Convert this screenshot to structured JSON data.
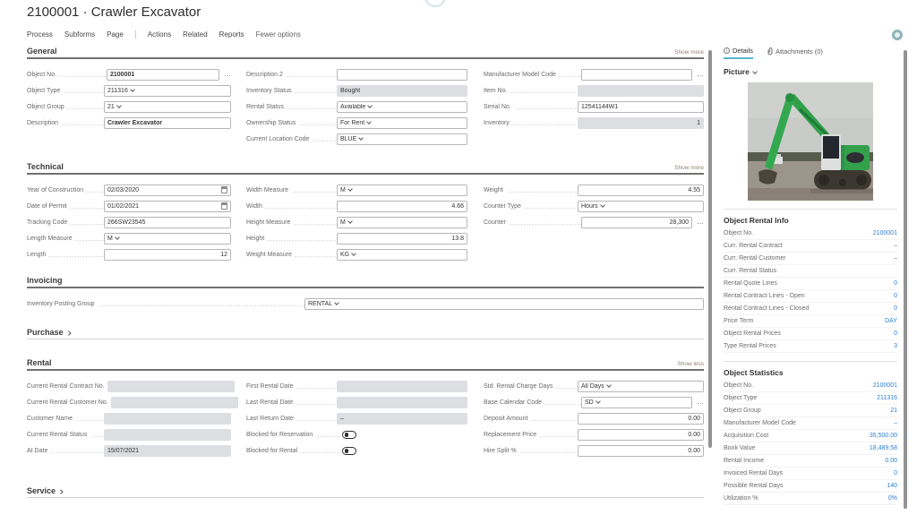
{
  "header": {
    "title": "2100001 · Crawler Excavator"
  },
  "menubar": {
    "items": [
      "Process",
      "Subforms",
      "Page",
      "Actions",
      "Related",
      "Reports",
      "Fewer options"
    ]
  },
  "icons": {
    "ellipsis": "…",
    "info": "i"
  },
  "general": {
    "title": "General",
    "more": "Show more",
    "objectNo": {
      "label": "Object No.",
      "value": "2100001"
    },
    "objectType": {
      "label": "Object Type",
      "value": "211316"
    },
    "objectGroup": {
      "label": "Object Group",
      "value": "21"
    },
    "description": {
      "label": "Description",
      "value": "Crawler Excavator"
    },
    "description2": {
      "label": "Description 2",
      "value": ""
    },
    "inventoryStatus": {
      "label": "Inventory Status",
      "value": "Bought"
    },
    "rentalStatus": {
      "label": "Rental Status",
      "value": "Available"
    },
    "ownershipStatus": {
      "label": "Ownership Status",
      "value": "For Rent"
    },
    "currentLocationCode": {
      "label": "Current Location Code",
      "value": "BLUE"
    },
    "manufacturerModelCode": {
      "label": "Manufacturer Model Code",
      "value": ""
    },
    "itemNo": {
      "label": "Item No.",
      "value": ""
    },
    "serialNo": {
      "label": "Serial No.",
      "value": "12541144W1"
    },
    "inventory": {
      "label": "Inventory",
      "value": "1"
    }
  },
  "technical": {
    "title": "Technical",
    "more": "Show more",
    "yearOfConstruction": {
      "label": "Year of Construction",
      "value": "02/03/2020"
    },
    "dateOfPermit": {
      "label": "Date of Permit",
      "value": "01/02/2021"
    },
    "trackingCode": {
      "label": "Tracking Code",
      "value": "266SW23545"
    },
    "lengthMeasure": {
      "label": "Length Measure",
      "value": "M"
    },
    "length": {
      "label": "Length",
      "value": "12"
    },
    "widthMeasure": {
      "label": "Width Measure",
      "value": "M"
    },
    "width": {
      "label": "Width",
      "value": "4.66"
    },
    "heightMeasure": {
      "label": "Height Measure",
      "value": "M"
    },
    "height": {
      "label": "Height",
      "value": "13.8"
    },
    "weightMeasure": {
      "label": "Weight Measure",
      "value": "KG"
    },
    "weight": {
      "label": "Weight",
      "value": "4.55"
    },
    "counterType": {
      "label": "Counter Type",
      "value": "Hours"
    },
    "counter": {
      "label": "Counter",
      "value": "28,300"
    }
  },
  "invoicing": {
    "title": "Invoicing",
    "inventoryPostingGroup": {
      "label": "Inventory Posting Group",
      "value": "RENTAL"
    }
  },
  "purchase": {
    "title": "Purchase"
  },
  "rental": {
    "title": "Rental",
    "less": "Show less",
    "currentRentalContractNo": {
      "label": "Current Rental Contract No.",
      "value": ""
    },
    "currentRentalCustomerNo": {
      "label": "Current Rental Customer No.",
      "value": ""
    },
    "customerName": {
      "label": "Customer Name",
      "value": ""
    },
    "currentRentalStatus": {
      "label": "Current Rental Status",
      "value": ""
    },
    "atDate": {
      "label": "At Date",
      "value": "15/07/2021"
    },
    "firstRentalDate": {
      "label": "First Rental Date",
      "value": ""
    },
    "lastRentalDate": {
      "label": "Last Rental Date",
      "value": ""
    },
    "lastReturnDate": {
      "label": "Last Return Date",
      "value": "–"
    },
    "blockedForReservation": {
      "label": "Blocked for Reservation"
    },
    "blockedForRental": {
      "label": "Blocked for Rental"
    },
    "stdRentalChargeDays": {
      "label": "Std. Rental Charge Days",
      "value": "All Days"
    },
    "baseCalendarCode": {
      "label": "Base Calendar Code",
      "value": "SD"
    },
    "depositAmount": {
      "label": "Deposit Amount",
      "value": "0.00"
    },
    "replacementPrice": {
      "label": "Replacement Price",
      "value": "0.00"
    },
    "hireSplit": {
      "label": "Hire Split %",
      "value": "0.00"
    }
  },
  "service": {
    "title": "Service"
  },
  "panel": {
    "tabs": {
      "details": "Details",
      "attachments": "Attachments (0)"
    },
    "picture": {
      "title": "Picture"
    },
    "rentalInfo": {
      "title": "Object Rental Info",
      "rows": [
        {
          "label": "Object No.",
          "value": "2100001"
        },
        {
          "label": "Curr. Rental Contract",
          "value": "–"
        },
        {
          "label": "Curr. Rental Customer",
          "value": "–"
        },
        {
          "label": "Curr. Rental Status",
          "value": ""
        },
        {
          "label": "Rental Quote Lines",
          "value": "0"
        },
        {
          "label": "Rental Contract Lines - Open",
          "value": "0"
        },
        {
          "label": "Rental Contract Lines - Closed",
          "value": "0"
        },
        {
          "label": "Price Term",
          "value": "DAY"
        },
        {
          "label": "Object Rental Prices",
          "value": "0"
        },
        {
          "label": "Type Rental Prices",
          "value": "3"
        }
      ]
    },
    "statistics": {
      "title": "Object Statistics",
      "rows": [
        {
          "label": "Object No.",
          "value": "2100001"
        },
        {
          "label": "Object Type",
          "value": "211316"
        },
        {
          "label": "Object Group",
          "value": "21"
        },
        {
          "label": "Manufacturer Model Code",
          "value": "–"
        },
        {
          "label": "Acquisition Cost",
          "value": "35,500.00"
        },
        {
          "label": "Book Value",
          "value": "18,489.58"
        },
        {
          "label": "Rental Income",
          "value": "0.00"
        },
        {
          "label": "Invoiced Rental Days",
          "value": "0"
        },
        {
          "label": "Possible Rental Days",
          "value": "140"
        },
        {
          "label": "Utilization %",
          "value": "0%"
        }
      ]
    }
  }
}
